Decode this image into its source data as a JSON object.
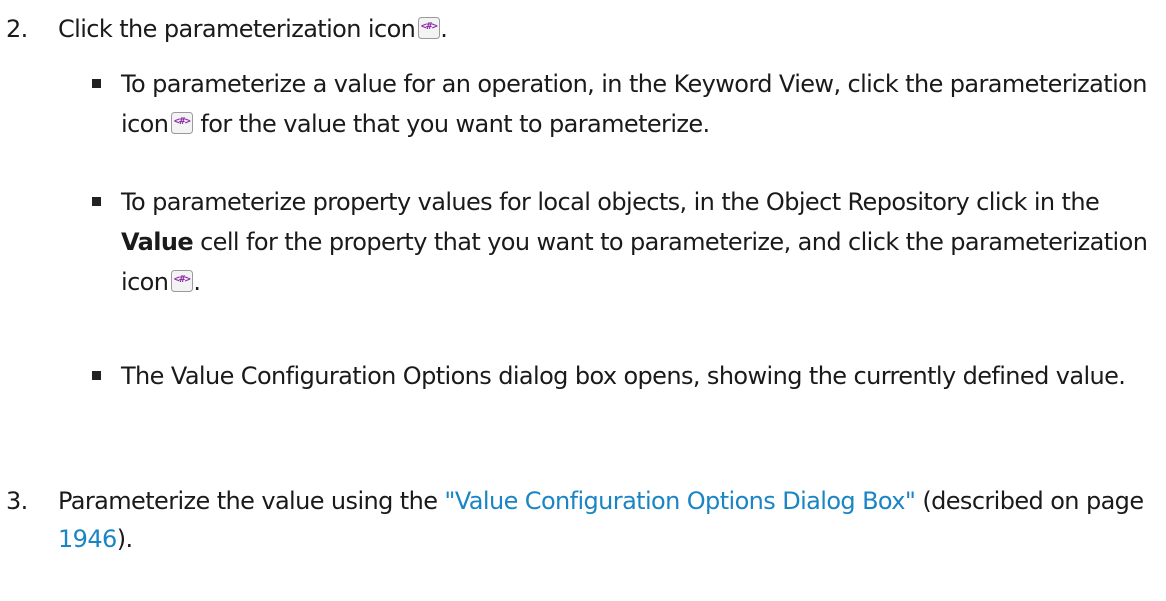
{
  "steps": [
    {
      "number": "2.",
      "text_before": "Click the parameterization icon",
      "text_after": "."
    },
    {
      "number": "3.",
      "text_before": "Parameterize the value using the ",
      "link_text": "\"Value Configuration Options Dialog Box\"",
      "text_middle": " (described on page ",
      "page_link": "1946",
      "text_after": ")."
    }
  ],
  "bullets": [
    {
      "text_before": "To parameterize a value for an operation, in the Keyword View, click the parameterization icon",
      "text_after": " for the value that you want to parameterize."
    },
    {
      "text_before": "To parameterize property values for local objects, in the Object Repository click in the ",
      "bold_text": "Value",
      "text_middle": " cell for the property that you want to parameterize, and click the parameterization icon",
      "text_after": "."
    },
    {
      "text": "The Value Configuration Options dialog box opens, showing the currently defined value."
    }
  ],
  "icons": {
    "parameterization": "parameterization-icon",
    "bullet": "square-bullet",
    "icon_border_color": "#9a9a9a",
    "icon_fill_color": "#f3f3f3",
    "icon_glyph_color": "#8e2aa8"
  },
  "colors": {
    "link": "#1a85c4",
    "text": "#1a1a1a"
  }
}
